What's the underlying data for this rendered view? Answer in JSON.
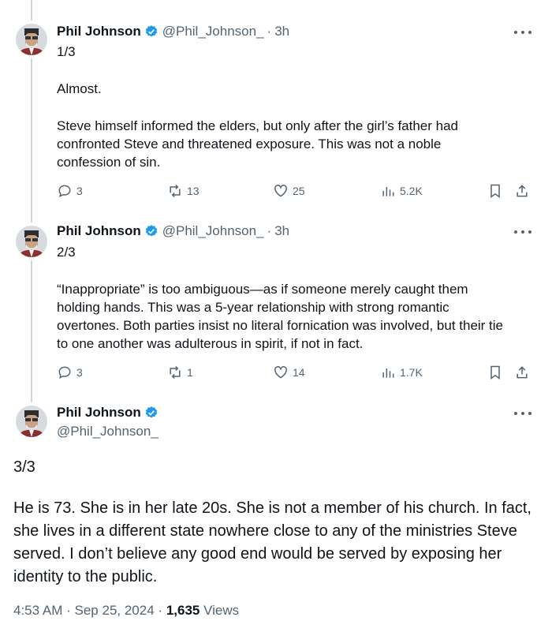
{
  "tweets": [
    {
      "author": "Phil Johnson",
      "handle": "@Phil_Johnson_",
      "separator": "·",
      "time": "3h",
      "counter": "1/3",
      "paragraphs": [
        "Almost.",
        "Steve himself informed the elders, but only after the girl’s father had confronted Steve and threatened exposure. This was not a noble confession of sin."
      ],
      "replies": "3",
      "reposts": "13",
      "likes": "25",
      "views": "5.2K"
    },
    {
      "author": "Phil Johnson",
      "handle": "@Phil_Johnson_",
      "separator": "·",
      "time": "3h",
      "counter": "2/3",
      "paragraphs": [
        "“Inappropriate” is too ambiguous—as if someone merely caught them holding hands. This was a 5-year relationship with strong romantic overtones. Both parties insist no literal fornication was involved, but their tie to one another was adulterous in spirit, if not in fact."
      ],
      "replies": "3",
      "reposts": "1",
      "likes": "14",
      "views": "1.7K"
    }
  ],
  "main_tweet": {
    "author": "Phil Johnson",
    "handle": "@Phil_Johnson_",
    "counter": "3/3",
    "body": "He is 73. She is in her late 20s. She is not a member of his church. In fact, she lives in a different state nowhere close to any of the ministries Steve served. I don’t believe any good end would be served by exposing her identity to the public.",
    "time": "4:53 AM",
    "date": "Sep 25, 2024",
    "separator": "·",
    "views_count": "1,635",
    "views_label": "Views"
  },
  "colors": {
    "verified_badge": "#1d9bf0",
    "secondary_text": "#536471",
    "thread_line": "#cfd9de"
  },
  "icons": [
    "reply-icon",
    "repost-icon",
    "like-icon",
    "views-icon",
    "bookmark-icon",
    "share-icon",
    "more-icon",
    "verified-badge-icon"
  ]
}
